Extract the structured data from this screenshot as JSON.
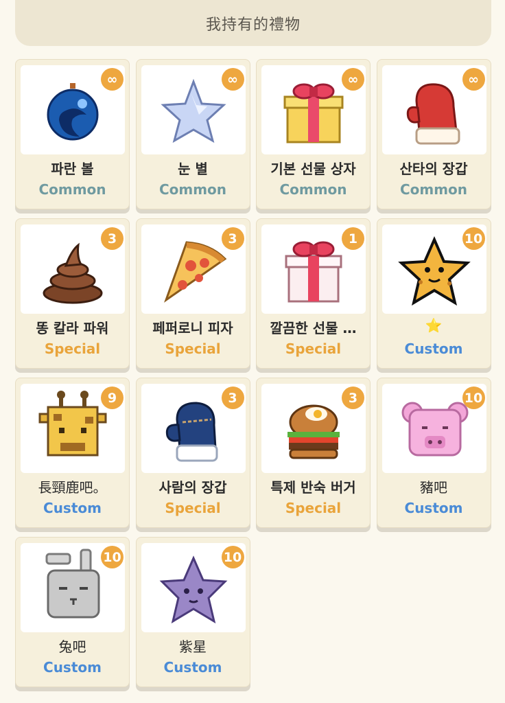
{
  "header": {
    "title": "我持有的禮物"
  },
  "colors": {
    "Common": "#6f9aa0",
    "Special": "#e9a43b",
    "Custom": "#4a8bd6"
  },
  "gifts": [
    {
      "name": "파란 볼",
      "rarity": "Common",
      "count": "∞",
      "icon": "blue-ornament-icon"
    },
    {
      "name": "눈 별",
      "rarity": "Common",
      "count": "∞",
      "icon": "snow-star-icon"
    },
    {
      "name": "기본 선물 상자",
      "rarity": "Common",
      "count": "∞",
      "icon": "gift-box-icon"
    },
    {
      "name": "산타의 장갑",
      "rarity": "Common",
      "count": "∞",
      "icon": "santa-mitten-icon"
    },
    {
      "name": "똥 칼라 파워",
      "rarity": "Special",
      "count": "3",
      "icon": "poop-icon"
    },
    {
      "name": "페퍼로니 피자",
      "rarity": "Special",
      "count": "3",
      "icon": "pizza-icon"
    },
    {
      "name": "깔끔한 선물 …",
      "rarity": "Special",
      "count": "1",
      "icon": "neat-gift-icon"
    },
    {
      "name": "⭐",
      "rarity": "Custom",
      "count": "10",
      "icon": "cookie-star-icon"
    },
    {
      "name": "長頸鹿吧。",
      "rarity": "Custom",
      "count": "9",
      "icon": "giraffe-icon"
    },
    {
      "name": "사람의 장갑",
      "rarity": "Special",
      "count": "3",
      "icon": "knit-mitten-icon"
    },
    {
      "name": "특제 반숙 버거",
      "rarity": "Special",
      "count": "3",
      "icon": "burger-icon"
    },
    {
      "name": "豬吧",
      "rarity": "Custom",
      "count": "10",
      "icon": "pig-icon"
    },
    {
      "name": "兔吧",
      "rarity": "Custom",
      "count": "10",
      "icon": "rabbit-icon"
    },
    {
      "name": "紫星",
      "rarity": "Custom",
      "count": "10",
      "icon": "purple-star-icon"
    }
  ]
}
